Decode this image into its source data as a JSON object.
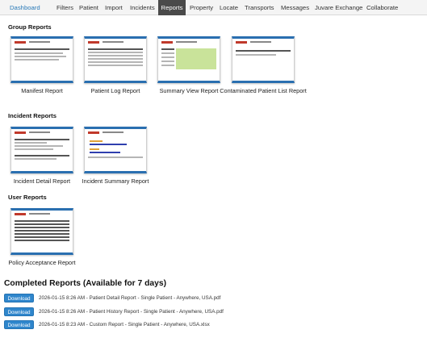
{
  "nav": {
    "items": [
      "Dashboard",
      "Filters",
      "Patient",
      "Import",
      "Incidents",
      "Reports",
      "Property",
      "Locate",
      "Transports",
      "Messages",
      "Juvare Exchange",
      "Collaborate"
    ],
    "active": "Reports"
  },
  "sections": {
    "group": {
      "title": "Group Reports",
      "cards": [
        "Manifest Report",
        "Patient Log Report",
        "Summary View Report",
        "Contaminated Patient List Report"
      ]
    },
    "incident": {
      "title": "Incident Reports",
      "cards": [
        "Incident Detail Report",
        "Incident Summary Report"
      ]
    },
    "user": {
      "title": "User Reports",
      "cards": [
        "Policy Acceptance Report"
      ]
    }
  },
  "completed": {
    "title": "Completed Reports (Available for 7 days)",
    "button_label": "Download",
    "items": [
      "2026-01-15 8:26 AM - Patient Detail Report - Single Patient - Anywhere, USA.pdf",
      "2026-01-15 8:26 AM - Patient History Report - Single Patient - Anywhere, USA.pdf",
      "2026-01-15 8:23 AM - Custom Report - Single Patient - Anywhere, USA.xlsx"
    ]
  },
  "colors": {
    "accent": "#2a6fb0",
    "button": "#2f86cc",
    "nav_active": "#4a4a4a"
  }
}
